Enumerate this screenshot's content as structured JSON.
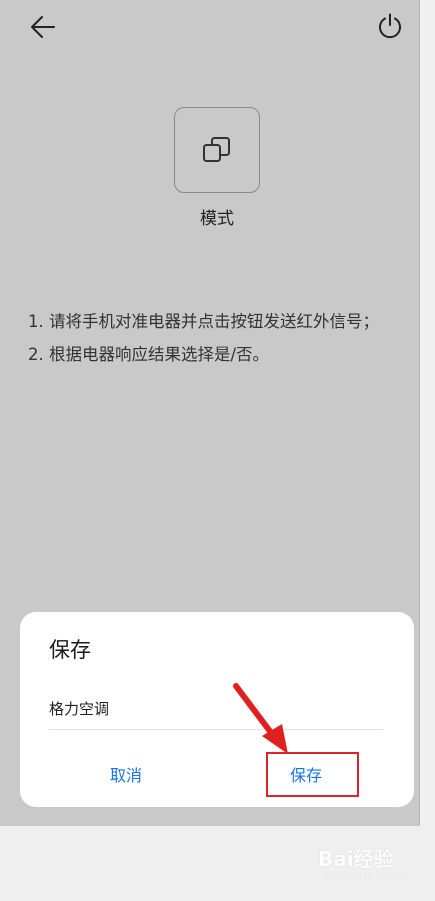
{
  "header": {
    "back_icon": "arrow-left-icon",
    "power_icon": "power-icon"
  },
  "mode": {
    "icon": "copy-square-icon",
    "label": "模式"
  },
  "instructions": [
    "1. 请将手机对准电器并点击按钮发送红外信号；",
    "2. 根据电器响应结果选择是/否。"
  ],
  "dialog": {
    "title": "保存",
    "input_value": "格力空调",
    "cancel_label": "取消",
    "save_label": "保存"
  },
  "annotation": {
    "color": "#d9232d"
  },
  "watermark": {
    "main": "Bai经验",
    "sub": "jingyan.baidu.com"
  },
  "colors": {
    "accent": "#1a73e8",
    "background": "#c9c9c9"
  }
}
